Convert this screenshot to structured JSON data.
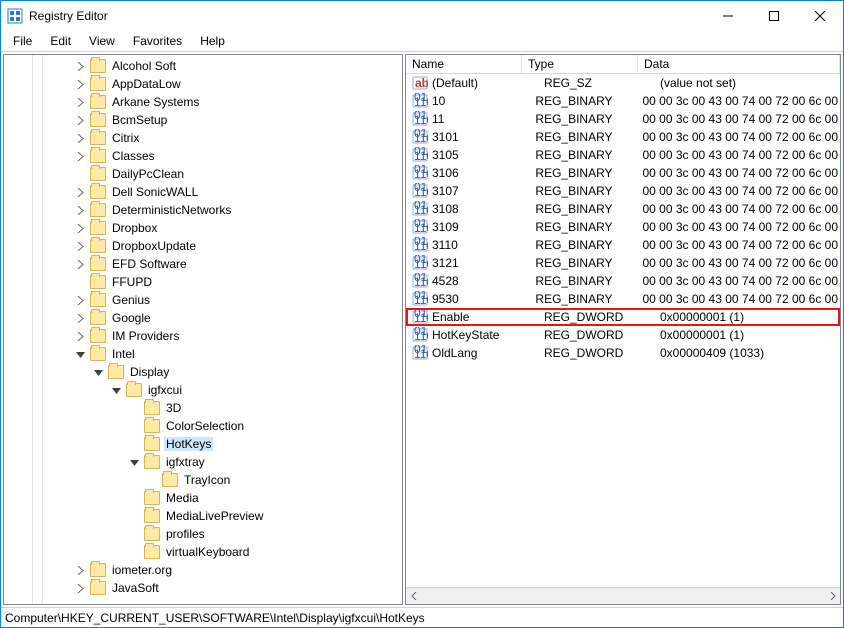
{
  "window": {
    "title": "Registry Editor"
  },
  "menu": [
    "File",
    "Edit",
    "View",
    "Favorites",
    "Help"
  ],
  "tree": [
    {
      "d": 4,
      "tw": ">",
      "l": "Alcohol Soft"
    },
    {
      "d": 4,
      "tw": ">",
      "l": "AppDataLow"
    },
    {
      "d": 4,
      "tw": ">",
      "l": "Arkane Systems"
    },
    {
      "d": 4,
      "tw": ">",
      "l": "BcmSetup"
    },
    {
      "d": 4,
      "tw": ">",
      "l": "Citrix"
    },
    {
      "d": 4,
      "tw": ">",
      "l": "Classes"
    },
    {
      "d": 4,
      "tw": "",
      "l": "DailyPcClean"
    },
    {
      "d": 4,
      "tw": ">",
      "l": "Dell SonicWALL"
    },
    {
      "d": 4,
      "tw": ">",
      "l": "DeterministicNetworks"
    },
    {
      "d": 4,
      "tw": ">",
      "l": "Dropbox"
    },
    {
      "d": 4,
      "tw": ">",
      "l": "DropboxUpdate"
    },
    {
      "d": 4,
      "tw": ">",
      "l": "EFD Software"
    },
    {
      "d": 4,
      "tw": "",
      "l": "FFUPD"
    },
    {
      "d": 4,
      "tw": ">",
      "l": "Genius"
    },
    {
      "d": 4,
      "tw": ">",
      "l": "Google"
    },
    {
      "d": 4,
      "tw": ">",
      "l": "IM Providers"
    },
    {
      "d": 4,
      "tw": "v",
      "l": "Intel"
    },
    {
      "d": 5,
      "tw": "v",
      "l": "Display"
    },
    {
      "d": 6,
      "tw": "v",
      "l": "igfxcui"
    },
    {
      "d": 7,
      "tw": "",
      "l": "3D"
    },
    {
      "d": 7,
      "tw": "",
      "l": "ColorSelection"
    },
    {
      "d": 7,
      "tw": "",
      "l": "HotKeys",
      "sel": true
    },
    {
      "d": 7,
      "tw": "v",
      "l": "igfxtray"
    },
    {
      "d": 8,
      "tw": "",
      "l": "TrayIcon"
    },
    {
      "d": 7,
      "tw": "",
      "l": "Media"
    },
    {
      "d": 7,
      "tw": "",
      "l": "MediaLivePreview"
    },
    {
      "d": 7,
      "tw": "",
      "l": "profiles"
    },
    {
      "d": 7,
      "tw": "",
      "l": "virtualKeyboard"
    },
    {
      "d": 4,
      "tw": ">",
      "l": "iometer.org"
    },
    {
      "d": 4,
      "tw": ">",
      "l": "JavaSoft"
    }
  ],
  "cols": {
    "name": "Name",
    "type": "Type",
    "data": "Data"
  },
  "rows": [
    {
      "icon": "str",
      "name": "(Default)",
      "type": "REG_SZ",
      "data": "(value not set)"
    },
    {
      "icon": "bin",
      "name": "10",
      "type": "REG_BINARY",
      "data": "00 00 3c 00 43 00 74 00 72 00 6c 00"
    },
    {
      "icon": "bin",
      "name": "11",
      "type": "REG_BINARY",
      "data": "00 00 3c 00 43 00 74 00 72 00 6c 00"
    },
    {
      "icon": "bin",
      "name": "3101",
      "type": "REG_BINARY",
      "data": "00 00 3c 00 43 00 74 00 72 00 6c 00"
    },
    {
      "icon": "bin",
      "name": "3105",
      "type": "REG_BINARY",
      "data": "00 00 3c 00 43 00 74 00 72 00 6c 00"
    },
    {
      "icon": "bin",
      "name": "3106",
      "type": "REG_BINARY",
      "data": "00 00 3c 00 43 00 74 00 72 00 6c 00"
    },
    {
      "icon": "bin",
      "name": "3107",
      "type": "REG_BINARY",
      "data": "00 00 3c 00 43 00 74 00 72 00 6c 00"
    },
    {
      "icon": "bin",
      "name": "3108",
      "type": "REG_BINARY",
      "data": "00 00 3c 00 43 00 74 00 72 00 6c 00"
    },
    {
      "icon": "bin",
      "name": "3109",
      "type": "REG_BINARY",
      "data": "00 00 3c 00 43 00 74 00 72 00 6c 00"
    },
    {
      "icon": "bin",
      "name": "3110",
      "type": "REG_BINARY",
      "data": "00 00 3c 00 43 00 74 00 72 00 6c 00"
    },
    {
      "icon": "bin",
      "name": "3121",
      "type": "REG_BINARY",
      "data": "00 00 3c 00 43 00 74 00 72 00 6c 00"
    },
    {
      "icon": "bin",
      "name": "4528",
      "type": "REG_BINARY",
      "data": "00 00 3c 00 43 00 74 00 72 00 6c 00"
    },
    {
      "icon": "bin",
      "name": "9530",
      "type": "REG_BINARY",
      "data": "00 00 3c 00 43 00 74 00 72 00 6c 00"
    },
    {
      "icon": "bin",
      "name": "Enable",
      "type": "REG_DWORD",
      "data": "0x00000001 (1)",
      "hl": true
    },
    {
      "icon": "bin",
      "name": "HotKeyState",
      "type": "REG_DWORD",
      "data": "0x00000001 (1)"
    },
    {
      "icon": "bin",
      "name": "OldLang",
      "type": "REG_DWORD",
      "data": "0x00000409 (1033)"
    }
  ],
  "status": "Computer\\HKEY_CURRENT_USER\\SOFTWARE\\Intel\\Display\\igfxcui\\HotKeys"
}
